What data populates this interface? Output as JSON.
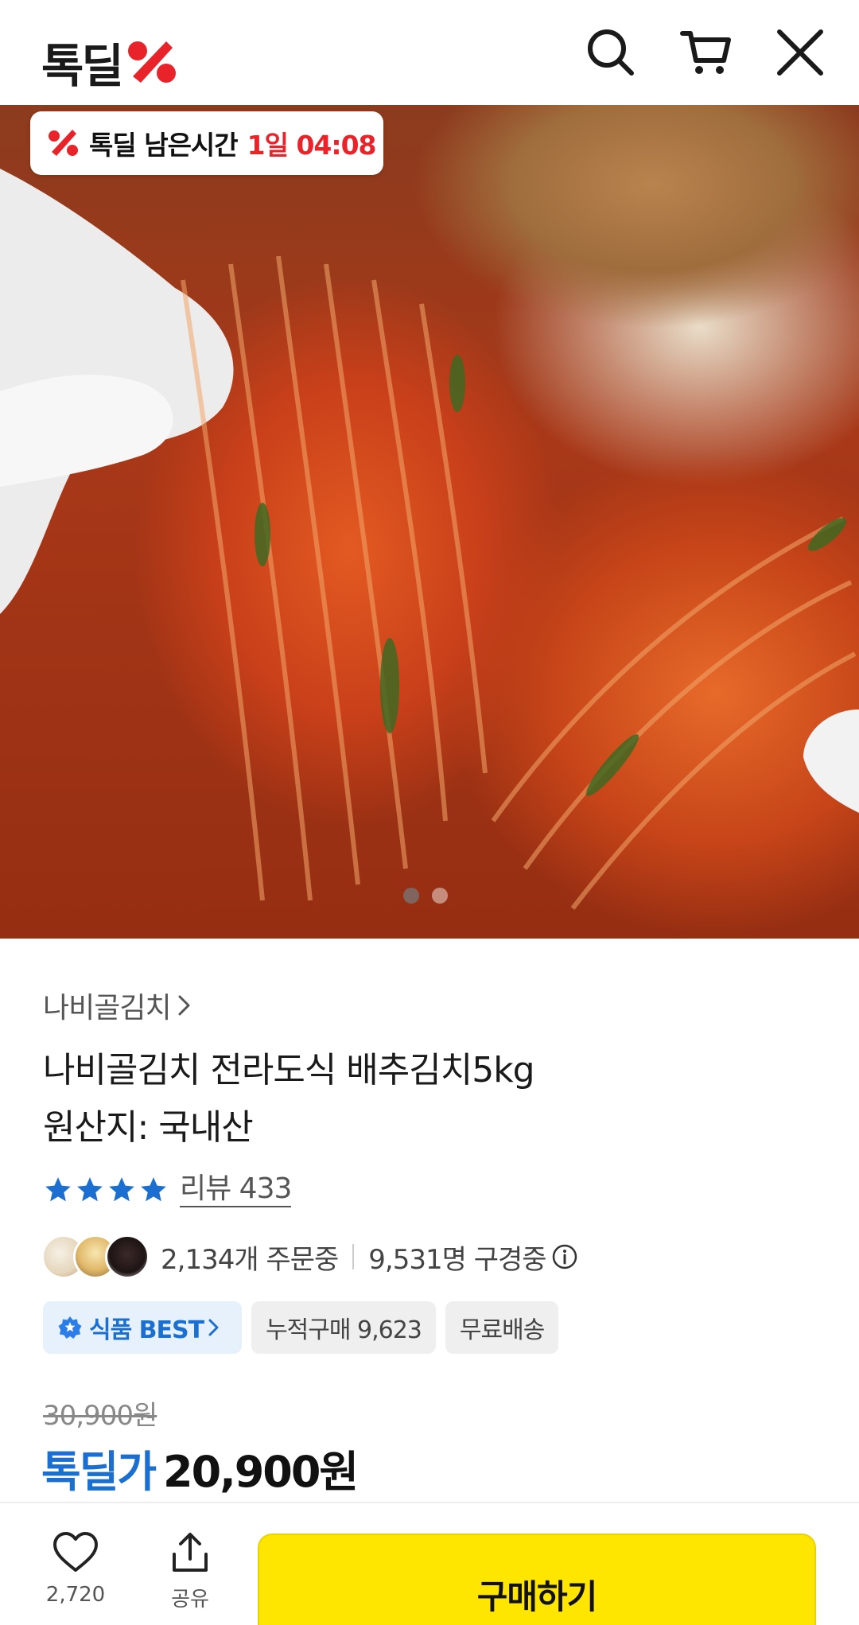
{
  "header": {
    "logo_text": "톡딜",
    "icons": [
      "search-icon",
      "cart-icon",
      "close-icon"
    ],
    "brand_color": "#e8242a"
  },
  "hero": {
    "timer_label": "톡딜 남은시간",
    "timer_value": "1일 04:08",
    "carousel_pages": 2,
    "carousel_active_index": 0
  },
  "product": {
    "seller": "나비골김치",
    "title_line1": "나비골김치 전라도식 배추김치5kg",
    "title_line2": "원산지: 국내산",
    "rating_stars": 4,
    "review_label": "리뷰 433",
    "orders_text": "2,134개 주문중",
    "viewers_text": "9,531명 구경중",
    "tags": [
      "식품 BEST",
      "누적구매 9,623",
      "무료배송"
    ],
    "original_price": "30,900원",
    "price_label": "톡딜가",
    "price_value": "20,900원",
    "accent_color": "#1a6fd0",
    "star_color": "#1a6fd0"
  },
  "bottom_bar": {
    "like_count": "2,720",
    "share_label": "공유",
    "buy_label": "구매하기",
    "buy_color": "#ffe600"
  }
}
